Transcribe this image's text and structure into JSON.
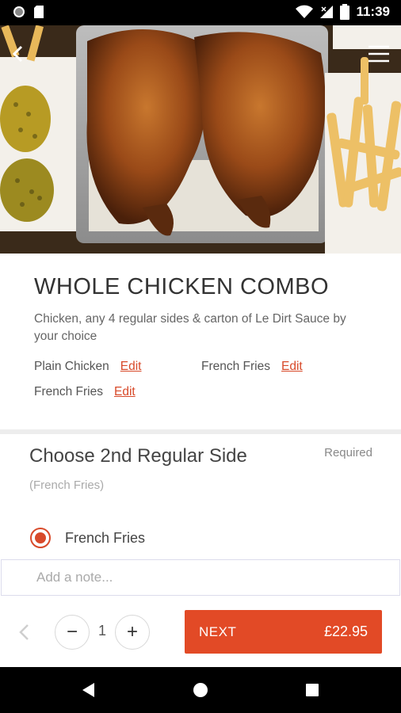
{
  "status_bar": {
    "time": "11:39",
    "icons": [
      "record-icon",
      "sd-card-icon",
      "wifi-icon",
      "signal-icon",
      "battery-icon"
    ]
  },
  "header": {
    "back_icon": "chevron-left-icon",
    "menu_icon": "hamburger-menu-icon"
  },
  "item": {
    "title": "WHOLE CHICKEN COMBO",
    "description": "Chicken, any 4 regular sides & carton of Le Dirt Sauce by your choice",
    "selections": [
      {
        "name": "Plain Chicken",
        "edit_label": "Edit"
      },
      {
        "name": "French Fries",
        "edit_label": "Edit"
      },
      {
        "name": "French Fries",
        "edit_label": "Edit"
      }
    ]
  },
  "choice": {
    "title": "Choose 2nd Regular Side",
    "required_label": "Required",
    "current_selection": "(French Fries)",
    "options": [
      {
        "label": "French Fries",
        "selected": true
      }
    ]
  },
  "note": {
    "placeholder": "Add a note..."
  },
  "footer": {
    "quantity": "1",
    "minus_label": "−",
    "plus_label": "+",
    "next_label": "NEXT",
    "price": "£22.95"
  },
  "colors": {
    "accent": "#e24a26",
    "edit_link": "#d84a2a"
  }
}
